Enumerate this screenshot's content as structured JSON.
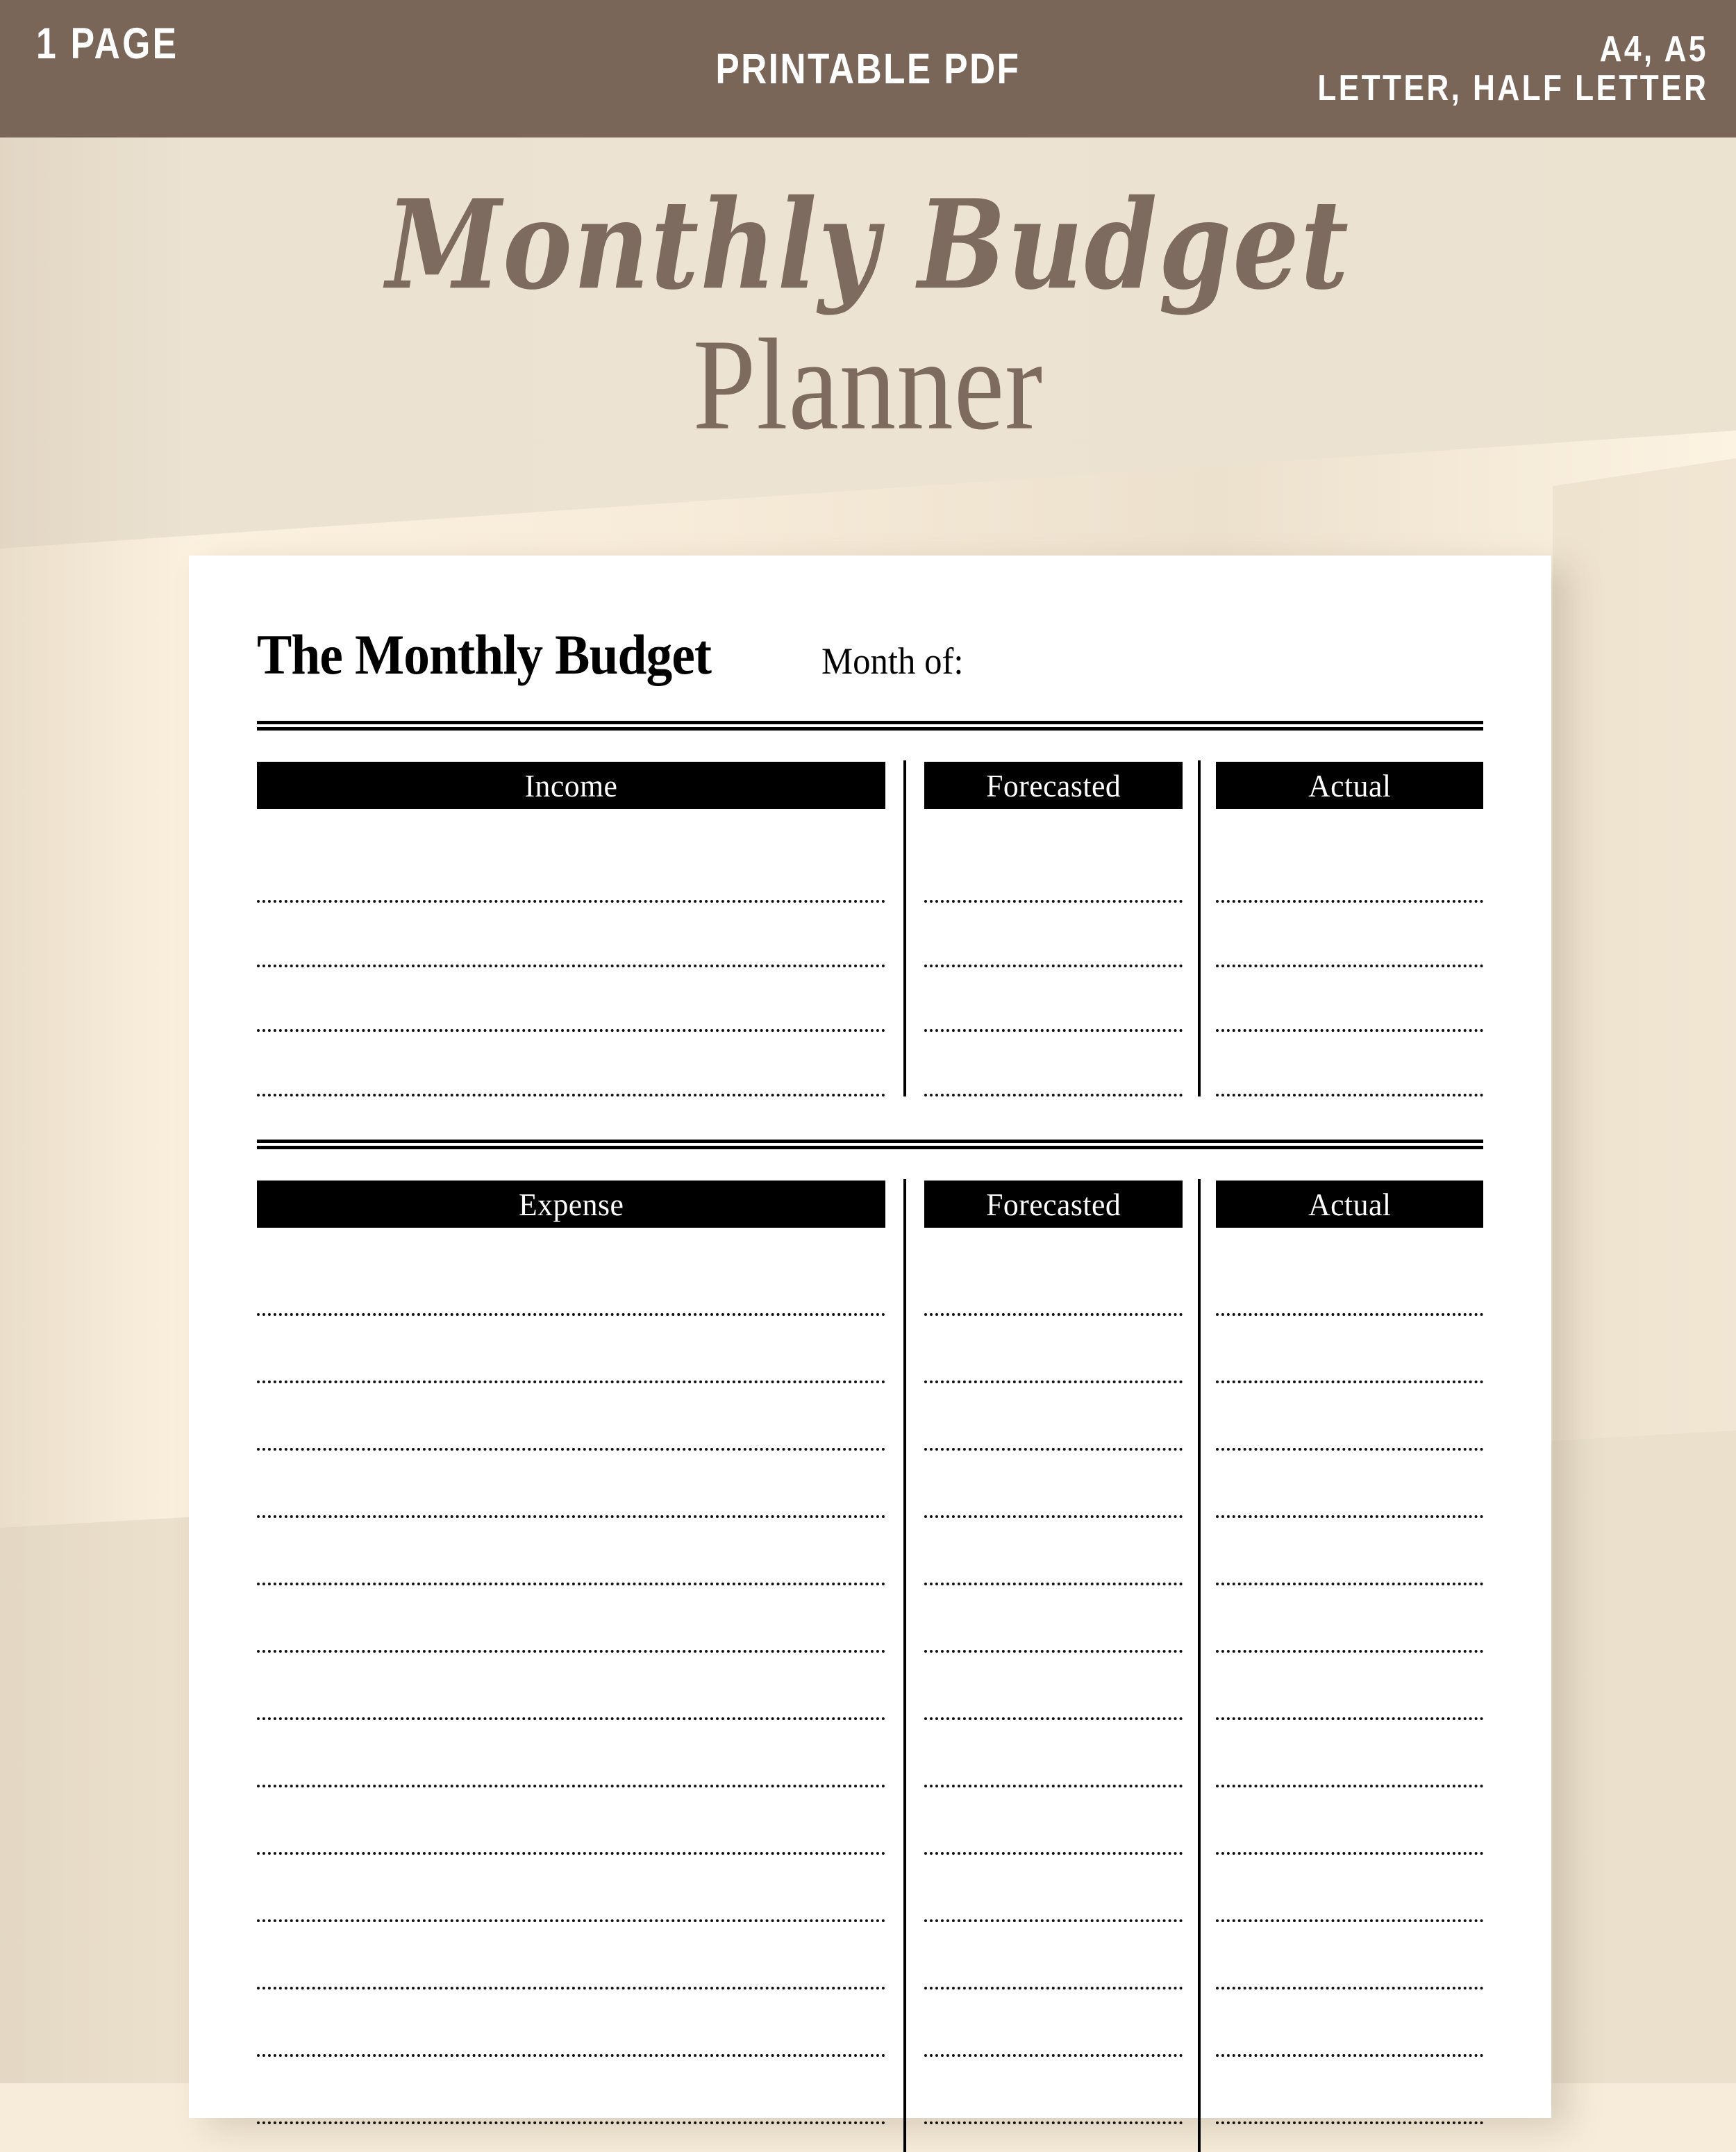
{
  "banner": {
    "left_label": "1 PAGE",
    "center_label": "PRINTABLE PDF",
    "right_line1": "A4, A5",
    "right_line2": "LETTER, HALF LETTER",
    "background_color": "#7a6659",
    "text_color": "#ffffff"
  },
  "hero": {
    "script_title": "Monthly Budget",
    "serif_title": "Planner",
    "color": "#7d6b5f",
    "background_color": "#ece3d3"
  },
  "sheet": {
    "document_title": "The Monthly Budget",
    "month_label": "Month of:",
    "income": {
      "column_headers": [
        "Income",
        "Forecasted",
        "Actual"
      ],
      "row_count": 4
    },
    "expense": {
      "column_headers": [
        "Expense",
        "Forecasted",
        "Actual"
      ],
      "row_count": 13
    }
  }
}
